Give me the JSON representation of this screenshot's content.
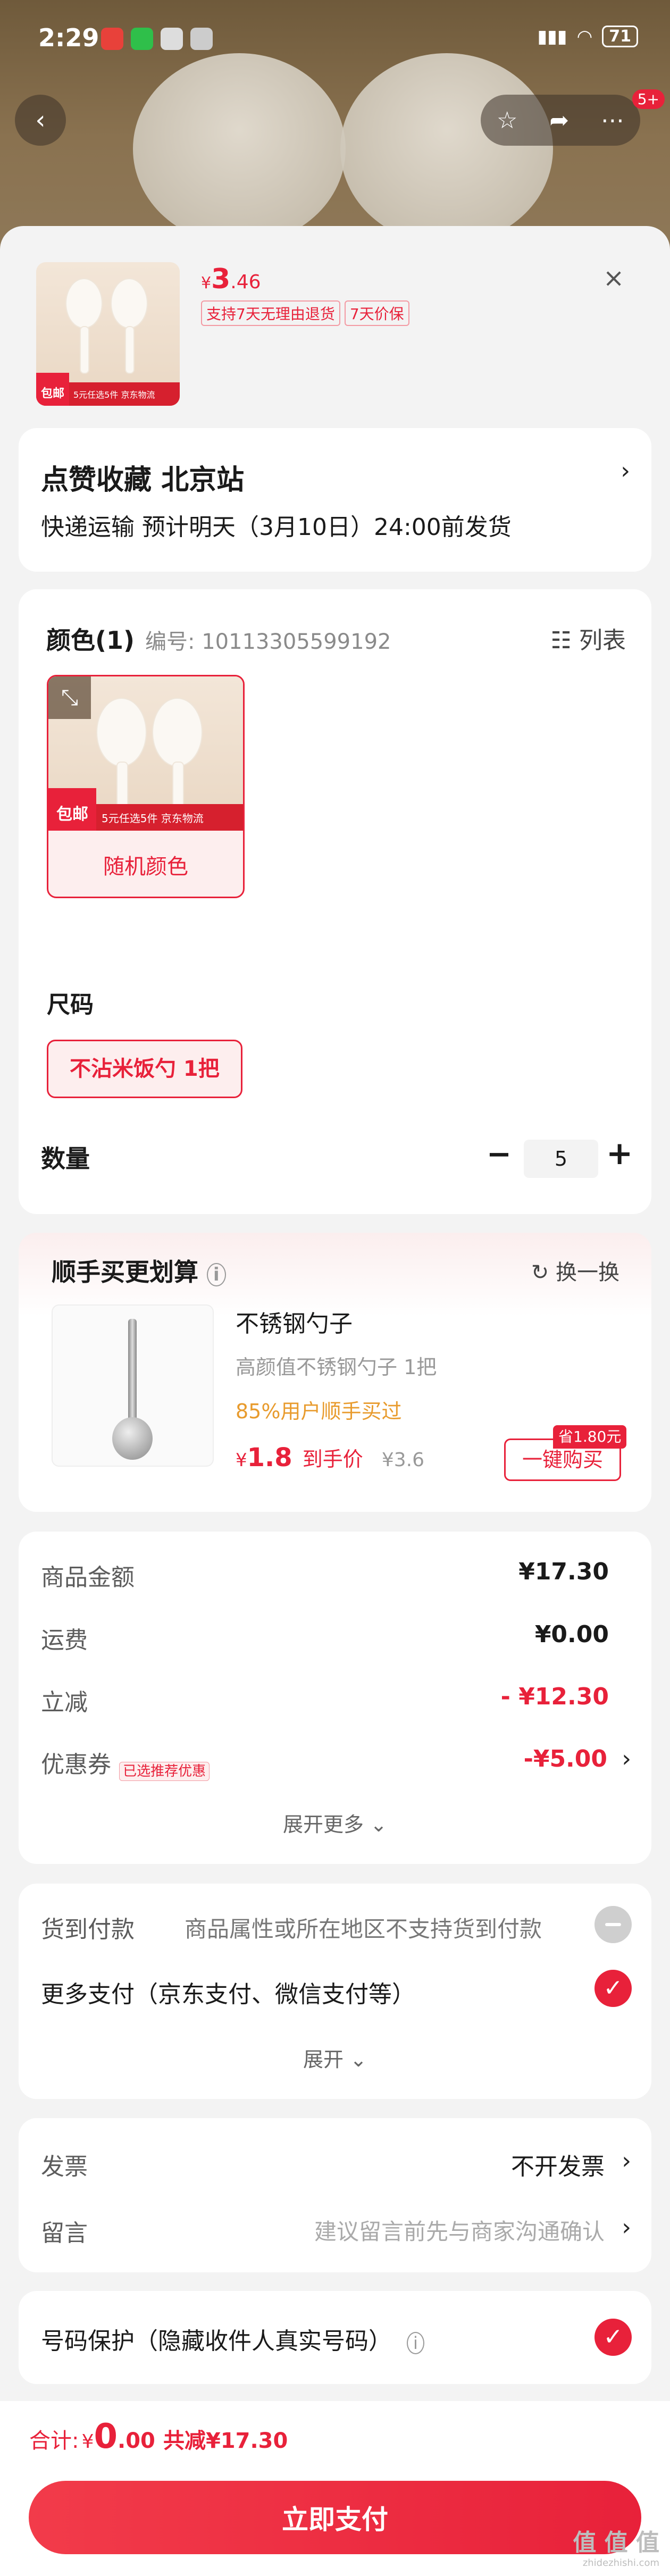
{
  "status_bar": {
    "time": "2:29",
    "battery": "71"
  },
  "product_header": {
    "currency": "¥",
    "price_int": "3",
    "price_dec": ".46",
    "tags": [
      "支持7天无理由退货",
      "7天价保"
    ],
    "thumb_tag": "包邮",
    "thumb_strip": "5元任选5件 京东物流"
  },
  "shipping": {
    "store": "点赞收藏  北京站",
    "info": "快递运输 预计明天（3月10日）24:00前发货"
  },
  "options": {
    "color_title": "颜色(1)",
    "sku_label": "编号: 10113305599192",
    "list_label": "列表",
    "color_option": "随机颜色",
    "size_title": "尺码",
    "size_option": "不沾米饭勺 1把",
    "qty_title": "数量",
    "qty_value": "5",
    "minus": "−",
    "plus": "+"
  },
  "addon": {
    "title": "顺手买更划算",
    "swap": "换一换",
    "name": "不锈钢勺子",
    "desc": "高颜值不锈钢勺子 1把",
    "popularity": "85%用户顺手买过",
    "price_symbol": "¥",
    "price": "1.8",
    "price_label": "到手价",
    "orig_price": "¥3.6",
    "save_badge": "省1.80元",
    "buy_button": "一键购买"
  },
  "summary": {
    "rows": [
      {
        "label": "商品金额",
        "value": "¥17.30"
      },
      {
        "label": "运费",
        "value": "¥0.00"
      },
      {
        "label": "立减",
        "value": "- ¥12.30"
      },
      {
        "label": "优惠券",
        "value": "-¥5.00",
        "badge": "已选推荐优惠"
      }
    ],
    "expand": "展开更多"
  },
  "payment": {
    "cod_label": "货到付款",
    "cod_note": "商品属性或所在地区不支持货到付款",
    "more_label": "更多支付（京东支付、微信支付等）",
    "expand": "展开"
  },
  "invoice": {
    "invoice_label": "发票",
    "invoice_value": "不开发票",
    "note_label": "留言",
    "note_placeholder": "建议留言前先与商家沟通确认"
  },
  "privacy": {
    "label": "号码保护（隐藏收件人真实号码）"
  },
  "footer": {
    "total_label": "合计:",
    "total_symbol": "¥",
    "total_int": "0",
    "total_dec": ".00",
    "discount": "共减¥17.30",
    "pay_button": "立即支付",
    "watermark": "值 值 值",
    "watermark_sub": "zhidezhishi.com"
  }
}
